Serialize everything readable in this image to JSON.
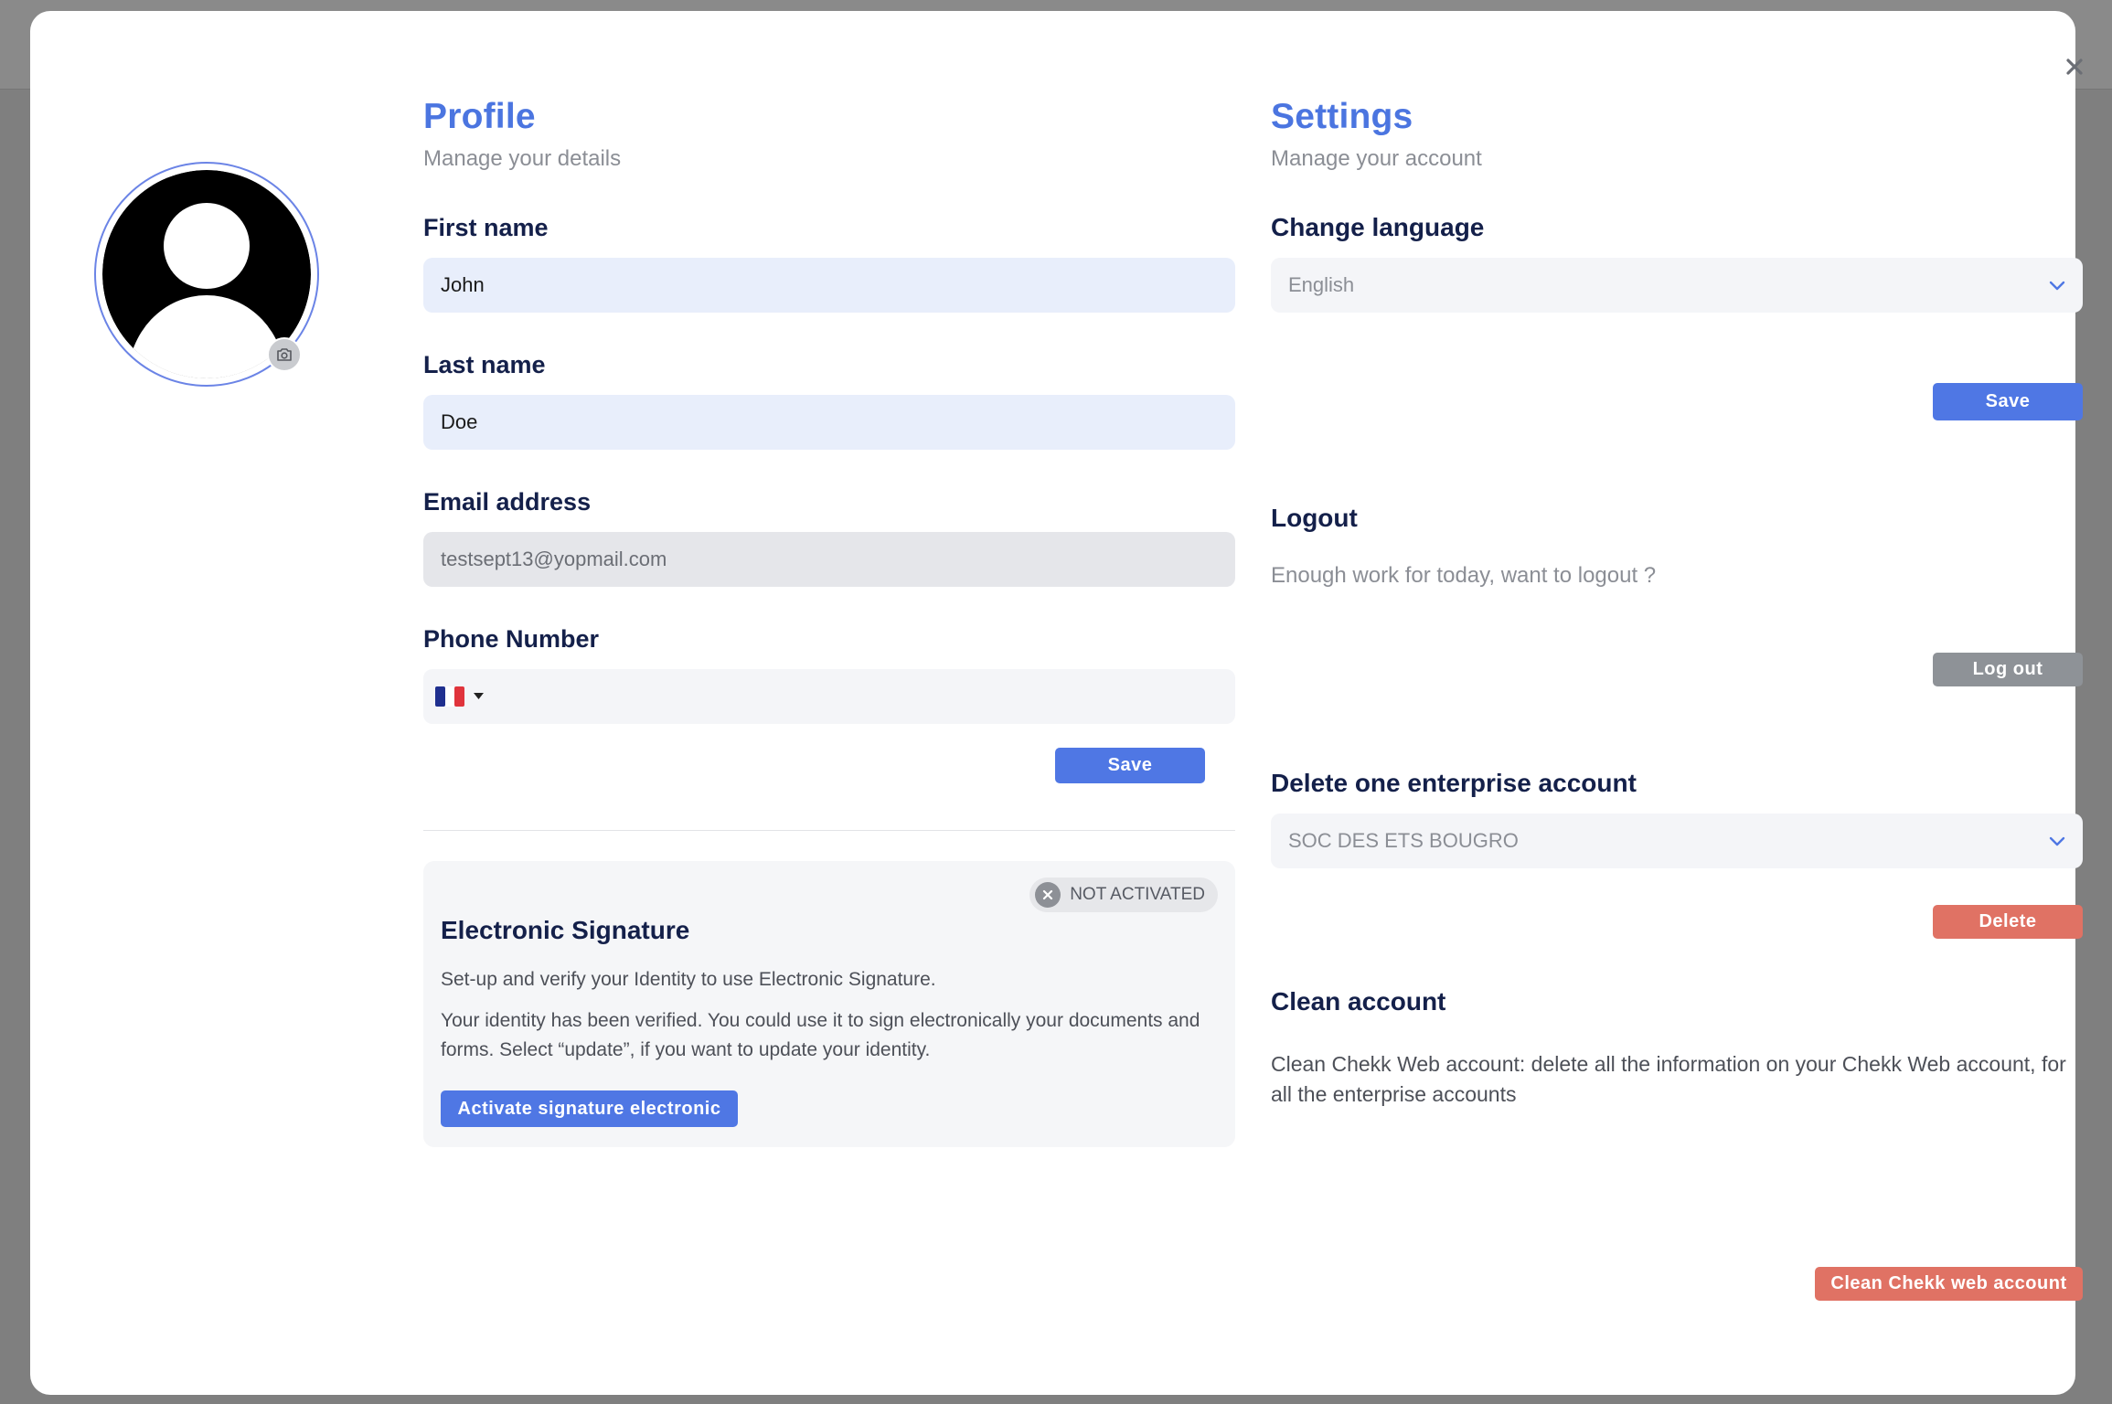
{
  "profile": {
    "title": "Profile",
    "subtitle": "Manage your details",
    "first_name_label": "First name",
    "first_name_value": "John",
    "last_name_label": "Last name",
    "last_name_value": "Doe",
    "email_label": "Email address",
    "email_value": "testsept13@yopmail.com",
    "phone_label": "Phone Number",
    "phone_country": "France",
    "save_label": "Save"
  },
  "signature": {
    "badge": "NOT ACTIVATED",
    "title": "Electronic Signature",
    "text1": "Set-up and verify your Identity to use Electronic Signature.",
    "text2": "Your identity has been verified. You could use it to sign electronically your documents and forms. Select “update”, if you want to update your identity.",
    "button": "Activate signature electronic"
  },
  "settings": {
    "title": "Settings",
    "subtitle": "Manage your account",
    "language_label": "Change language",
    "language_value": "English",
    "save_label": "Save",
    "logout_title": "Logout",
    "logout_text": "Enough work for today, want to logout ?",
    "logout_button": "Log out",
    "delete_title": "Delete one enterprise account",
    "delete_value": "SOC DES ETS BOUGRO",
    "delete_button": "Delete",
    "clean_title": "Clean account",
    "clean_text": "Clean Chekk Web account: delete all the information on your Chekk Web account, for all the enterprise accounts",
    "clean_button": "Clean Chekk web account"
  },
  "colors": {
    "accent": "#4f77e4",
    "danger": "#e07264",
    "neutral_button": "#8e9297",
    "heading": "#14204a"
  },
  "icons": [
    "close-icon",
    "avatar-placeholder-icon",
    "camera-icon",
    "flag-france-icon",
    "caret-down-icon",
    "chevron-down-icon",
    "x-circle-icon"
  ]
}
